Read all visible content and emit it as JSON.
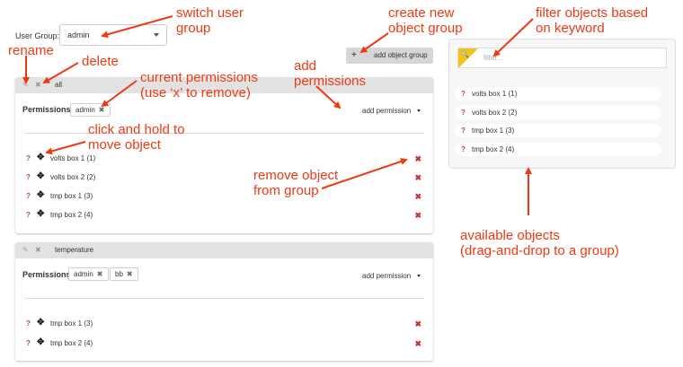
{
  "user_group": {
    "label": "User Group:",
    "value": "admin"
  },
  "add_group_button": {
    "icon": "plus-icon",
    "label": "add object group"
  },
  "groups": [
    {
      "name": "all",
      "permissions_label": "Permissions",
      "permissions": [
        "admin"
      ],
      "add_permission_label": "add permission",
      "objects": [
        "volts box 1 (1)",
        "volts box 2 (2)",
        "tmp box 1 (3)",
        "tmp box 2 (4)"
      ]
    },
    {
      "name": "temperature",
      "permissions_label": "Permissions",
      "permissions": [
        "admin",
        "bb"
      ],
      "add_permission_label": "add permission",
      "objects": [
        "tmp box 1 (3)",
        "tmp box 2 (4)"
      ]
    }
  ],
  "icons": {
    "rename": "pencil-icon",
    "delete": "x-icon",
    "move": "move-arrows-icon",
    "help": "question-icon",
    "remove": "x-icon",
    "search": "search-icon"
  },
  "glyphs": {
    "edit": "✎",
    "x": "✖",
    "move": "✥",
    "help": "?",
    "chip_x": "✖",
    "plus": "+",
    "search": "🔍"
  },
  "available": {
    "filter_placeholder": "filter...",
    "items": [
      "volts box 1 (1)",
      "volts box 2 (2)",
      "tmp box 1 (3)",
      "tmp box 2 (4)"
    ]
  },
  "annotations": {
    "switch": "switch user\ngroup",
    "create": "create new\nobject group",
    "filter": "filter objects based\non keyword",
    "rename": "rename",
    "delete": "delete",
    "current": "current permissions\n(use ‘x’ to remove)",
    "add": "add\npermissions",
    "click": "click and hold to\nmove object",
    "remove": "remove object\nfrom group",
    "available": "available objects\n(drag-and-drop to a group)"
  },
  "colors": {
    "annotation": "#ee3a13",
    "help": "#c0377d",
    "remove": "#cc3333",
    "filter_accent": "#f2c31b",
    "header": "#e2e2e2"
  }
}
